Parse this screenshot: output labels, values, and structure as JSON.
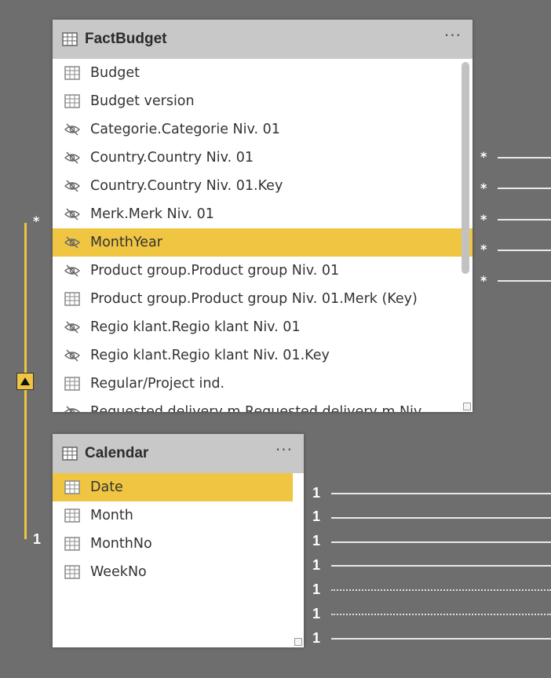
{
  "fact_table": {
    "title": "FactBudget",
    "more": "···",
    "rows": [
      {
        "label": "Budget",
        "icon": "table-icon"
      },
      {
        "label": "Budget version",
        "icon": "table-icon"
      },
      {
        "label": "Categorie.Categorie Niv. 01",
        "icon": "hidden-icon"
      },
      {
        "label": "Country.Country Niv. 01",
        "icon": "hidden-icon"
      },
      {
        "label": "Country.Country Niv. 01.Key",
        "icon": "hidden-icon"
      },
      {
        "label": "Merk.Merk Niv. 01",
        "icon": "hidden-icon"
      },
      {
        "label": "MonthYear",
        "icon": "hidden-icon",
        "selected": true
      },
      {
        "label": "Product group.Product group Niv. 01",
        "icon": "hidden-icon"
      },
      {
        "label": "Product group.Product group Niv. 01.Merk (Key)",
        "icon": "table-icon"
      },
      {
        "label": "Regio klant.Regio klant Niv. 01",
        "icon": "hidden-icon"
      },
      {
        "label": "Regio klant.Regio klant Niv. 01.Key",
        "icon": "hidden-icon"
      },
      {
        "label": "Regular/Project ind.",
        "icon": "table-icon"
      },
      {
        "label": "Requested delivery m.Requested delivery m Niv",
        "icon": "hidden-icon"
      }
    ]
  },
  "calendar_table": {
    "title": "Calendar",
    "more": "···",
    "rows": [
      {
        "label": "Date",
        "icon": "table-icon",
        "selected": true
      },
      {
        "label": "Month",
        "icon": "table-icon"
      },
      {
        "label": "MonthNo",
        "icon": "table-icon"
      },
      {
        "label": "WeekNo",
        "icon": "table-icon"
      }
    ]
  },
  "relationship": {
    "many_marker": "*",
    "one_marker": "1",
    "direction": "up",
    "accent_color": "#f0c541"
  },
  "right_many_markers": [
    "*",
    "*",
    "*",
    "*",
    "*"
  ],
  "right_one_markers": [
    "1",
    "1",
    "1",
    "1",
    "1",
    "1",
    "1"
  ]
}
